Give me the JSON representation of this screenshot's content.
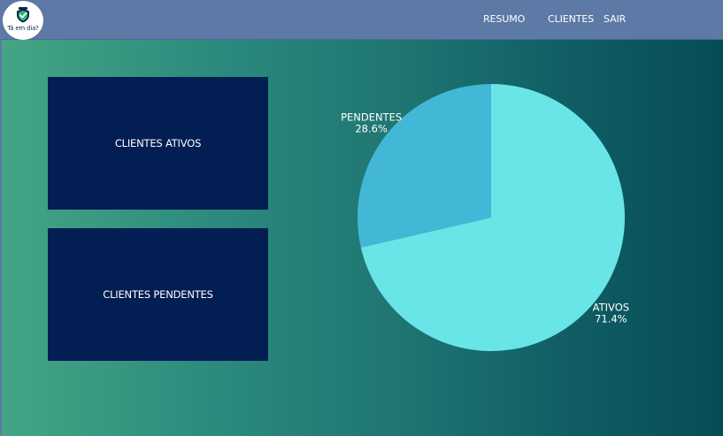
{
  "header": {
    "logo_text": "Tá em dia?",
    "nav": {
      "resumo": "RESUMO",
      "clientes": "CLIENTES",
      "sair": "SAIR"
    }
  },
  "cards": {
    "ativos_label": "CLIENTES ATIVOS",
    "pendentes_label": "CLIENTES PENDENTES"
  },
  "colors": {
    "header_bg": "#5d79a5",
    "card_bg": "#021e53",
    "ativos_slice": "#69e5e8",
    "pendentes_slice": "#43b8d6"
  },
  "chart_data": {
    "type": "pie",
    "title": "",
    "slices": [
      {
        "label": "ATIVOS",
        "value": 71.4,
        "display": "71.4%",
        "color": "#69e5e8"
      },
      {
        "label": "PENDENTES",
        "value": 28.6,
        "display": "28.6%",
        "color": "#43b8d6"
      }
    ]
  }
}
